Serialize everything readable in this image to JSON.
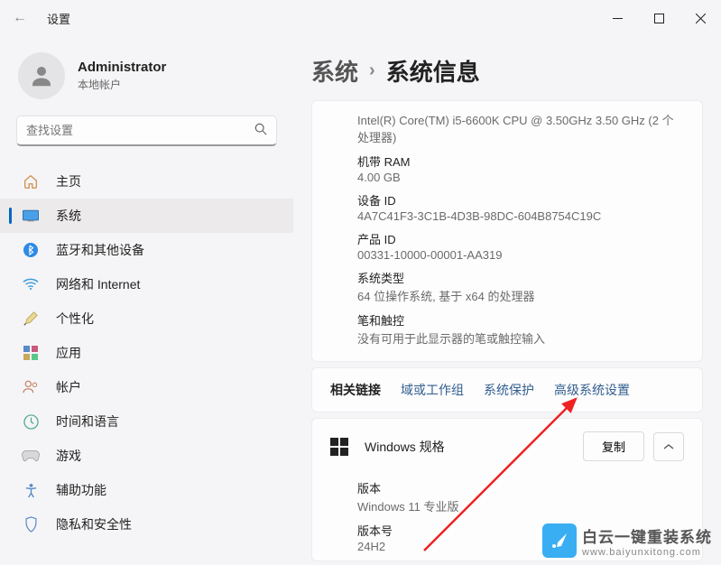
{
  "titlebar": {
    "title": "设置"
  },
  "user": {
    "name": "Administrator",
    "sub": "本地帐户"
  },
  "search": {
    "placeholder": "查找设置"
  },
  "nav": {
    "home": "主页",
    "system": "系统",
    "bluetooth": "蓝牙和其他设备",
    "network": "网络和 Internet",
    "personalize": "个性化",
    "apps": "应用",
    "accounts": "帐户",
    "time": "时间和语言",
    "gaming": "游戏",
    "accessibility": "辅助功能",
    "privacy": "隐私和安全性"
  },
  "breadcrumb": {
    "p1": "系统",
    "p2": "系统信息"
  },
  "specs": {
    "cpu_val": "Intel(R) Core(TM) i5-6600K CPU @ 3.50GHz   3.50 GHz (2 个处理器)",
    "ram_k": "机带 RAM",
    "ram_v": "4.00 GB",
    "devid_k": "设备 ID",
    "devid_v": "4A7C41F3-3C1B-4D3B-98DC-604B8754C19C",
    "prodid_k": "产品 ID",
    "prodid_v": "00331-10000-00001-AA319",
    "systype_k": "系统类型",
    "systype_v": "64 位操作系统, 基于 x64 的处理器",
    "pen_k": "笔和触控",
    "pen_v": "没有可用于此显示器的笔或触控输入"
  },
  "links": {
    "label": "相关链接",
    "l1": "域或工作组",
    "l2": "系统保护",
    "l3": "高级系统设置"
  },
  "winspec": {
    "title": "Windows 规格",
    "copy": "复制",
    "ver_k": "版本",
    "ver_v": "Windows 11 专业版",
    "build_k": "版本号",
    "build_v": "24H2"
  },
  "watermark": {
    "line1": "白云一键重装系统",
    "line2": "www.baiyunxitong.com"
  }
}
